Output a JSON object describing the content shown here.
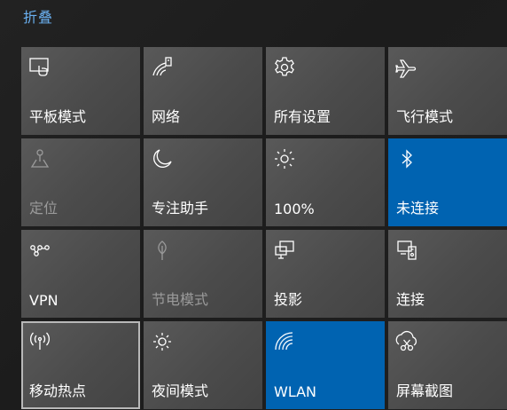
{
  "collapse_label": "折叠",
  "tiles": [
    {
      "label": "平板模式",
      "icon": "tablet-mode-icon"
    },
    {
      "label": "网络",
      "icon": "network-icon"
    },
    {
      "label": "所有设置",
      "icon": "gear-icon"
    },
    {
      "label": "飞行模式",
      "icon": "airplane-icon"
    },
    {
      "label": "定位",
      "icon": "location-icon",
      "state": "disabled"
    },
    {
      "label": "专注助手",
      "icon": "moon-icon"
    },
    {
      "label": "100%",
      "icon": "brightness-icon"
    },
    {
      "label": "未连接",
      "icon": "bluetooth-icon",
      "state": "active"
    },
    {
      "label": "VPN",
      "icon": "vpn-icon"
    },
    {
      "label": "节电模式",
      "icon": "battery-saver-icon",
      "state": "disabled"
    },
    {
      "label": "投影",
      "icon": "project-icon"
    },
    {
      "label": "连接",
      "icon": "connect-icon"
    },
    {
      "label": "移动热点",
      "icon": "mobile-hotspot-icon",
      "state": "selected"
    },
    {
      "label": "夜间模式",
      "icon": "night-light-icon"
    },
    {
      "label": "WLAN",
      "icon": "wifi-icon",
      "state": "active"
    },
    {
      "label": "屏幕截图",
      "icon": "screen-snip-icon"
    }
  ],
  "colors": {
    "accent": "#0063b1",
    "link": "#6ab0f0",
    "tile": "#4f4f4f"
  }
}
